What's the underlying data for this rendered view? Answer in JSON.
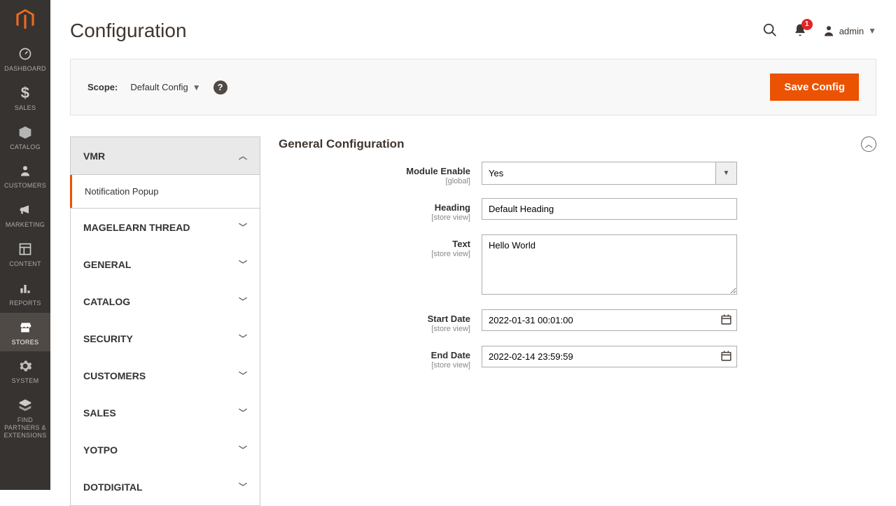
{
  "sidebar": {
    "items": [
      {
        "label": "DASHBOARD"
      },
      {
        "label": "SALES"
      },
      {
        "label": "CATALOG"
      },
      {
        "label": "CUSTOMERS"
      },
      {
        "label": "MARKETING"
      },
      {
        "label": "CONTENT"
      },
      {
        "label": "REPORTS"
      },
      {
        "label": "STORES"
      },
      {
        "label": "SYSTEM"
      },
      {
        "label": "FIND PARTNERS & EXTENSIONS"
      }
    ]
  },
  "header": {
    "title": "Configuration",
    "notification_count": "1",
    "user": "admin"
  },
  "scope": {
    "label": "Scope:",
    "value": "Default Config",
    "save_label": "Save Config"
  },
  "nav": {
    "groups": [
      {
        "label": "VMR",
        "sub": "Notification Popup"
      },
      {
        "label": "MAGELEARN THREAD"
      },
      {
        "label": "GENERAL"
      },
      {
        "label": "CATALOG"
      },
      {
        "label": "SECURITY"
      },
      {
        "label": "CUSTOMERS"
      },
      {
        "label": "SALES"
      },
      {
        "label": "YOTPO"
      },
      {
        "label": "DOTDIGITAL"
      }
    ]
  },
  "section": {
    "title": "General Configuration",
    "fields": {
      "module_enable": {
        "label": "Module Enable",
        "scope": "[global]",
        "value": "Yes"
      },
      "heading": {
        "label": "Heading",
        "scope": "[store view]",
        "value": "Default Heading"
      },
      "text": {
        "label": "Text",
        "scope": "[store view]",
        "value": "Hello World"
      },
      "start_date": {
        "label": "Start Date",
        "scope": "[store view]",
        "value": "2022-01-31 00:01:00"
      },
      "end_date": {
        "label": "End Date",
        "scope": "[store view]",
        "value": "2022-02-14 23:59:59"
      }
    }
  }
}
